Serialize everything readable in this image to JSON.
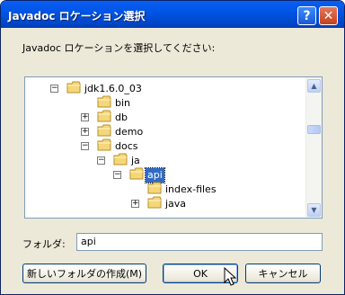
{
  "window": {
    "title": "Javadoc ロケーション選択",
    "help_glyph": "?",
    "close_glyph": "✕"
  },
  "prompt": "Javadoc ロケーションを選択してください:",
  "tree": {
    "items": [
      {
        "label": "jdk1.6.0_03",
        "expander": "−"
      },
      {
        "label": "bin",
        "expander": ""
      },
      {
        "label": "db",
        "expander": "+"
      },
      {
        "label": "demo",
        "expander": "+"
      },
      {
        "label": "docs",
        "expander": "−"
      },
      {
        "label": "ja",
        "expander": "−"
      },
      {
        "label": "api",
        "expander": "−",
        "selected": true
      },
      {
        "label": "index-files",
        "expander": ""
      },
      {
        "label": "java",
        "expander": "+"
      }
    ]
  },
  "folder_field": {
    "label": "フォルダ:",
    "value": "api"
  },
  "buttons": {
    "new_folder": "新しいフォルダの作成(M)",
    "ok": "OK",
    "cancel": "キャンセル"
  },
  "icons": {
    "folder": "folder-icon",
    "scroll_up": "chevron-up-icon",
    "scroll_down": "chevron-down-icon",
    "cursor": "mouse-pointer-icon"
  },
  "colors": {
    "title_bar": "#0055e5",
    "selection": "#316ac5",
    "dialog_bg": "#ece9d8",
    "folder": "#f5d77a"
  }
}
